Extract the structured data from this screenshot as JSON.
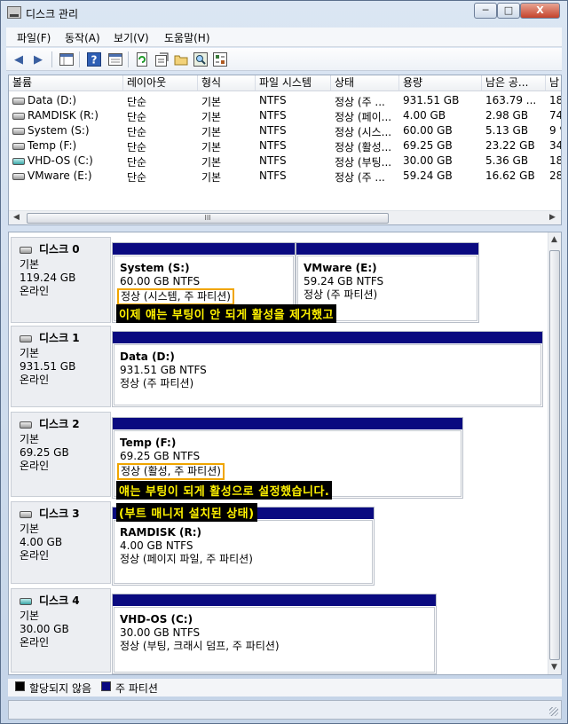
{
  "window": {
    "title": "디스크 관리",
    "minimize_glyph": "─",
    "maximize_glyph": "□",
    "close_glyph": "X"
  },
  "menu": [
    "파일(F)",
    "동작(A)",
    "보기(V)",
    "도움말(H)"
  ],
  "toolbar": {
    "icons": [
      "back-arrow-icon",
      "forward-arrow-icon",
      "show-hide-console-icon",
      "help-icon",
      "properties-pane-icon",
      "refresh-icon",
      "properties-icon",
      "open-folder-icon",
      "search-icon",
      "settings-icon"
    ]
  },
  "volume_list": {
    "columns": [
      "볼륨",
      "레이아웃",
      "형식",
      "파일 시스템",
      "상태",
      "용량",
      "남은 공...",
      "남"
    ],
    "rows": [
      {
        "icon": "drive-icon",
        "volume": "Data (D:)",
        "layout": "단순",
        "type": "기본",
        "fs": "NTFS",
        "status": "정상 (주 ...",
        "capacity": "931.51 GB",
        "free": "163.79 ...",
        "pct": "18"
      },
      {
        "icon": "drive-icon",
        "volume": "RAMDISK (R:)",
        "layout": "단순",
        "type": "기본",
        "fs": "NTFS",
        "status": "정상 (페이...",
        "capacity": "4.00 GB",
        "free": "2.98 GB",
        "pct": "74"
      },
      {
        "icon": "drive-icon",
        "volume": "System (S:)",
        "layout": "단순",
        "type": "기본",
        "fs": "NTFS",
        "status": "정상 (시스...",
        "capacity": "60.00 GB",
        "free": "5.13 GB",
        "pct": "9 %"
      },
      {
        "icon": "drive-icon",
        "volume": "Temp (F:)",
        "layout": "단순",
        "type": "기본",
        "fs": "NTFS",
        "status": "정상 (활성...",
        "capacity": "69.25 GB",
        "free": "23.22 GB",
        "pct": "34"
      },
      {
        "icon": "vhd-drive-icon",
        "volume": "VHD-OS (C:)",
        "layout": "단순",
        "type": "기본",
        "fs": "NTFS",
        "status": "정상 (부팅...",
        "capacity": "30.00 GB",
        "free": "5.36 GB",
        "pct": "18"
      },
      {
        "icon": "drive-icon",
        "volume": "VMware (E:)",
        "layout": "단순",
        "type": "기본",
        "fs": "NTFS",
        "status": "정상 (주 ...",
        "capacity": "59.24 GB",
        "free": "16.62 GB",
        "pct": "28"
      }
    ],
    "scroll_thumb_glyph": "III"
  },
  "disks": [
    {
      "name": "디스크 0",
      "type": "기본",
      "size": "119.24 GB",
      "state": "온라인",
      "partitions": [
        {
          "name": "System  (S:)",
          "size": "60.00 GB NTFS",
          "status": "정상 (시스템, 주 파티션)"
        },
        {
          "name": "VMware  (E:)",
          "size": "59.24 GB NTFS",
          "status": "정상 (주 파티션)"
        }
      ],
      "annotation": "이제 얘는 부팅이 안 되게 활성을 제거했고"
    },
    {
      "name": "디스크 1",
      "type": "기본",
      "size": "931.51 GB",
      "state": "온라인",
      "partitions": [
        {
          "name": "Data  (D:)",
          "size": "931.51 GB NTFS",
          "status": "정상 (주 파티션)"
        }
      ]
    },
    {
      "name": "디스크 2",
      "type": "기본",
      "size": "69.25 GB",
      "state": "온라인",
      "partitions": [
        {
          "name": "Temp  (F:)",
          "size": "69.25 GB NTFS",
          "status": "정상 (활성, 주 파티션)"
        }
      ],
      "annotation": "얘는 부팅이 되게 활성으로 설정했습니다.",
      "annotation2": "(부트 매니저 설치된 상태)"
    },
    {
      "name": "디스크 3",
      "type": "기본",
      "size": "4.00 GB",
      "state": "온라인",
      "partitions": [
        {
          "name": "RAMDISK  (R:)",
          "size": "4.00 GB NTFS",
          "status": "정상 (페이지 파일, 주 파티션)"
        }
      ]
    },
    {
      "name": "디스크 4",
      "type": "기본",
      "size": "30.00 GB",
      "state": "온라인",
      "partitions": [
        {
          "name": "VHD-OS  (C:)",
          "size": "30.00 GB NTFS",
          "status": "정상 (부팅, 크래시 덤프, 주 파티션)"
        }
      ]
    }
  ],
  "legend": [
    {
      "label": "할당되지 않음",
      "color": "#000000"
    },
    {
      "label": "주 파티션",
      "color": "#0a0a80"
    }
  ],
  "colors": {
    "partition_bar": "#0a0a80",
    "highlight_border": "#f0a500",
    "annotation_text": "#fff200"
  }
}
